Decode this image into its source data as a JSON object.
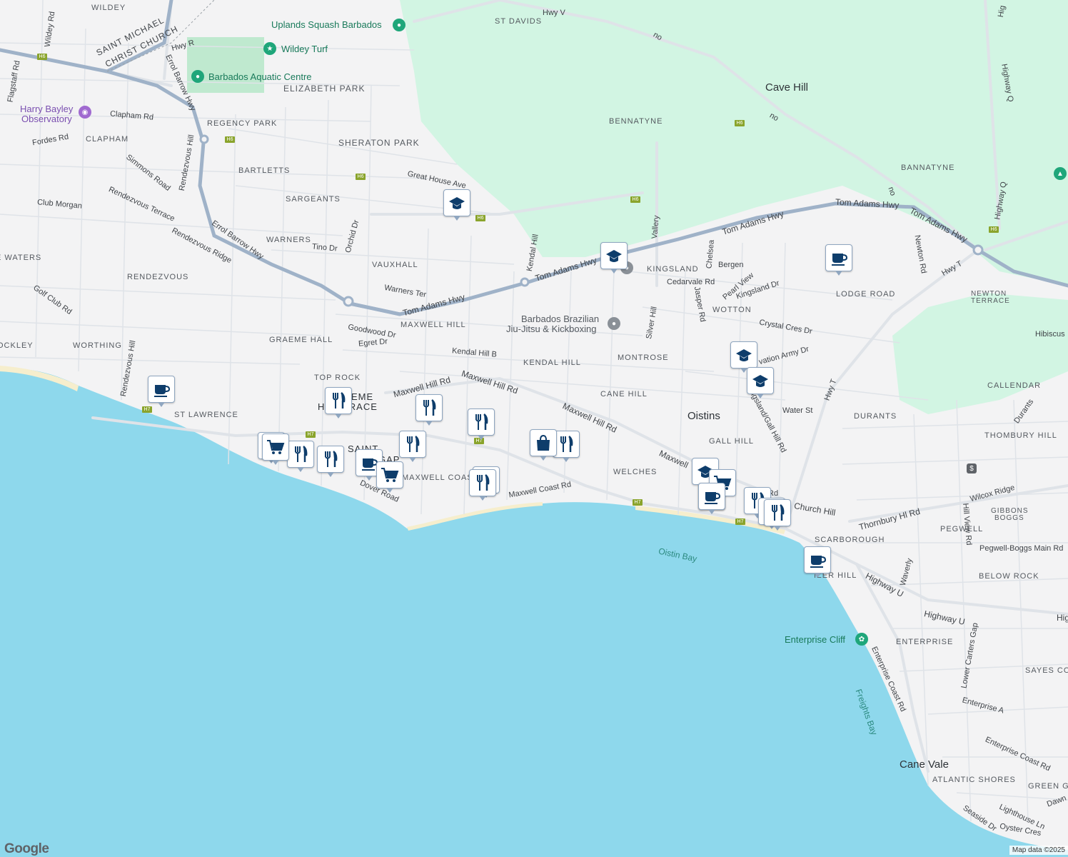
{
  "map": {
    "attribution": "Map data ©2025",
    "logo": "Google",
    "colors": {
      "land": "#f3f3f4",
      "water": "#8ed8ec",
      "park": "#d2f5e3",
      "highway": "#9fb2c8",
      "road": "#dfe3e8"
    }
  },
  "labels": {
    "wildey": "WILDEY",
    "st_davids": "ST DAVIDS",
    "saint_michael": "SAINT MICHAEL",
    "christ_church": "CHRIST CHURCH",
    "elizabeth_park": "ELIZABETH PARK",
    "cave_hill": "Cave Hill",
    "bennatyne": "BENNATYNE",
    "regency_park": "REGENCY PARK",
    "clapham": "CLAPHAM",
    "sheraton_park": "SHERATON PARK",
    "bartletts": "BARTLETTS",
    "bannatyne": "BANNATYNE",
    "sargeants": "SARGEANTS",
    "warners": "WARNERS",
    "vauxhall": "VAUXHALL",
    "kingsland": "KINGSLAND",
    "waters": "E WATERS",
    "rendezvous": "RENDEZVOUS",
    "lodge_road": "LODGE ROAD",
    "newton_terrace_1": "NEWTON",
    "newton_terrace_2": "TERRACE",
    "wotton": "WOTTON",
    "maxwell_hill": "MAXWELL HILL",
    "graeme_hall": "GRAEME HALL",
    "worthing": "WORTHING",
    "ockley": "OCKLEY",
    "montrose": "MONTROSE",
    "kendal_hill": "KENDAL HILL",
    "top_rock": "TOP ROCK",
    "callendar": "CALLENDAR",
    "cane_hill": "CANE HILL",
    "graeme_hall_terrace_1": "EME",
    "graeme_hall_terrace_2": "H TERRACE",
    "oistins": "Oistins",
    "durants": "DURANTS",
    "st_lawrence": "ST LAWRENCE",
    "thornbury_hill": "THOMBURY HILL",
    "gall_hill": "GALL HILL",
    "saint": "SAINT",
    "r_gap": "R GAP",
    "maxwell_coast": "MAXWELL COAST",
    "welches": "WELCHES",
    "gibbons_1": "GIBBONS",
    "gibbons_2": "BOGGS",
    "pegwell": "PEGWELL",
    "scarborough": "SCARBOROUGH",
    "below_rock": "BELOW ROCK",
    "fizer_hill": "IZER HILL",
    "enterprise": "ENTERPRISE",
    "sayes_court": "SAYES COU",
    "cane_vale": "Cane Vale",
    "atlantic_shores": "ATLANTIC SHORES",
    "green_garden": "GREEN GA"
  },
  "pois": {
    "uplands": "Uplands Squash Barbados",
    "wildey_turf": "Wildey Turf",
    "aquatic": "Barbados Aquatic Centre",
    "harry_1": "Harry Bayley",
    "harry_2": "Observatory",
    "bjj_1": "Barbados Brazilian",
    "bjj_2": "Jiu-Jitsu & Kickboxing",
    "enterprise_cliff": "Enterprise Cliff"
  },
  "water_labels": {
    "oistin_bay": "Oistin Bay",
    "freights_bay": "Freights Bay"
  },
  "roads": {
    "hwy_v": "Hwy V",
    "hwy_r": "Hwy R",
    "wildey_rd": "Wildey Rd",
    "flagstaff": "Flagstaff Rd",
    "errol_1": "Errol Barrow Hwy",
    "errol_2": "Errol Barrow Hwy",
    "clapham_rd": "Clapham Rd",
    "fordes_rd": "Fordes Rd",
    "simmons": "Simmons Road",
    "rendezvous_hill": "Rendezvous Hill",
    "rendezvous_hill_2": "Rendezvous Hill",
    "rendezvous_terrace": "Rendezvous Terrace",
    "rendezvous_ridge": "Rendezvous Ridge",
    "club_morgan": "Club Morgan",
    "golf_club": "Golf Club Rd",
    "great_house": "Great House Ave",
    "tino": "Tino Dr",
    "orchid": "Orchid Dr",
    "warners_ter": "Warners Ter",
    "tom_adams_1": "Tom Adams Hwy",
    "tom_adams_2": "Tom Adams Hwy",
    "tom_adams_3": "Tom Adams Hwy",
    "tom_adams_4": "Tom Adams Hwy",
    "tom_adams_5": "Tom Adams Hwy",
    "kendal_hill_rd": "Kendal Hill",
    "kendal_hill_b": "Kendal Hill B",
    "goodwood": "Goodwood Dr",
    "egret": "Egret Dr",
    "maxwell_hill_rd_1": "Maxwell Hill Rd",
    "maxwell_hill_rd_2": "Maxwell Hill Rd",
    "maxwell_hill_rd_3": "Maxwell Hill Rd",
    "maxwell_1": "Maxwell",
    "maxwell_coast_rd": "Maxwell Coast Rd",
    "dover": "Dover Road",
    "vallery": "Vallery",
    "silver_hill": "Silver Hill",
    "chelsea": "Chelsea",
    "bergen": "Bergen",
    "cedarvale": "Cedarvale Rd",
    "jasper": "Jasper Rd",
    "pearl_view": "Pearl View",
    "kingsland_dr": "Kingsland Dr",
    "crystal": "Crystal Cres Dr",
    "salvation": "vation Army Dr",
    "kingsland_gall": "Kingsland/Gall Hill Rd",
    "water_st": "Water St",
    "hwy_t_1": "Hwy T",
    "hwy_t_2": "Hwy T",
    "newton_rd": "Newton Rd",
    "highway_q_1": "Highway Q",
    "highway_q_2": "Highway Q",
    "no_1": "no",
    "no_2": "no",
    "no_3": "no",
    "durants": "Durants",
    "hibiscus": "Hibiscus",
    "church_hill": "Church Hill",
    "thornbury_hl": "Thornbury Hl Rd",
    "wilcox": "Wilcox Ridge",
    "hill_view": "Hill View Rd",
    "pegwell_boggs": "Pegwell-Boggs Main Rd",
    "waverly": "Waverly",
    "highway_u_1": "Highway U",
    "highway_u_2": "Highway U",
    "hig": "Hig",
    "hig2": "Hig",
    "lower_carters": "Lower Carters Gap",
    "enterprise_a": "Enterprise A",
    "enterprise_coast_1": "Enterprise Coast Rd",
    "enterprise_coast_2": "Enterprise Coast Rd",
    "lighthouse": "Lighthouse Ln",
    "oyster": "Oyster Cres",
    "seaside": "Seaside Dr",
    "dawn": "Dawn",
    "rd_short": "Rd"
  },
  "shields": [
    "H6",
    "H6",
    "H6",
    "H6",
    "H6",
    "H6",
    "H6",
    "H7",
    "H7",
    "H7",
    "H7",
    "H7"
  ]
}
